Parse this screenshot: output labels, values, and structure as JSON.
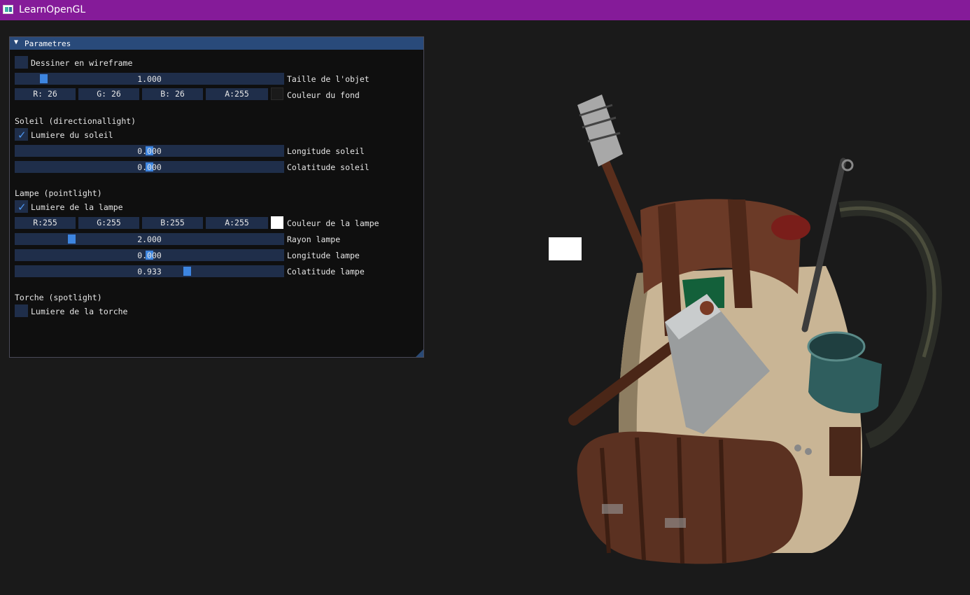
{
  "window": {
    "title": "LearnOpenGL"
  },
  "panel": {
    "title": "Parametres",
    "wireframe": {
      "label": "Dessiner en wireframe",
      "checked": false
    },
    "object_size": {
      "value": "1.000",
      "label": "Taille de l'objet"
    },
    "background_color": {
      "r": "R: 26",
      "g": "G: 26",
      "b": "B: 26",
      "a": "A:255",
      "label": "Couleur du fond",
      "swatch": "#1a1a1a"
    },
    "sun": {
      "heading": "Soleil (directionallight)",
      "enable": {
        "label": "Lumiere du soleil",
        "checked": true
      },
      "longitude": {
        "value": "0.000",
        "label": "Longitude soleil"
      },
      "colatitude": {
        "value": "0.000",
        "label": "Colatitude soleil"
      }
    },
    "lamp": {
      "heading": "Lampe (pointlight)",
      "enable": {
        "label": "Lumiere de la lampe",
        "checked": true
      },
      "color": {
        "r": "R:255",
        "g": "G:255",
        "b": "B:255",
        "a": "A:255",
        "label": "Couleur de la lampe",
        "swatch": "#ffffff"
      },
      "radius": {
        "value": "2.000",
        "label": "Rayon lampe"
      },
      "longitude": {
        "value": "0.000",
        "label": "Longitude lampe"
      },
      "colatitude": {
        "value": "0.933",
        "label": "Colatitude lampe"
      }
    },
    "torch": {
      "heading": "Torche (spotlight)",
      "enable": {
        "label": "Lumiere de la torche",
        "checked": false
      }
    }
  },
  "colors": {
    "titlebar": "#851b99",
    "panel_header": "#294a7a",
    "frame_bg": "#1f2e4a",
    "accent": "#3d85e0",
    "background": "#1a1a1a"
  }
}
